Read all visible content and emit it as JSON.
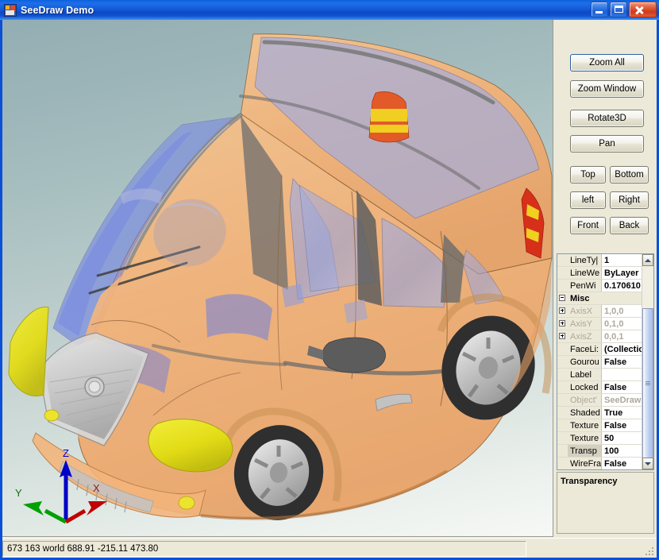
{
  "window": {
    "title": "SeeDraw Demo",
    "icon": "app-icon",
    "controls": {
      "minimize": "Minimize",
      "maximize": "Maximize",
      "close": "Close"
    }
  },
  "toolbar": {
    "buttons": [
      {
        "label": "Zoom All",
        "name": "zoom-all-button"
      },
      {
        "label": "Zoom Window",
        "name": "zoom-window-button"
      },
      {
        "label": "Rotate3D",
        "name": "rotate3d-button"
      },
      {
        "label": "Pan",
        "name": "pan-button"
      },
      {
        "label": "Top",
        "name": "view-top-button"
      },
      {
        "label": "Bottom",
        "name": "view-bottom-button"
      },
      {
        "label": "left",
        "name": "view-left-button"
      },
      {
        "label": "Right",
        "name": "view-right-button"
      },
      {
        "label": "Front",
        "name": "view-front-button"
      },
      {
        "label": "Back",
        "name": "view-back-button"
      }
    ]
  },
  "property_grid": {
    "rows": [
      {
        "expander": "none",
        "name": "LineTy|",
        "value": "1",
        "dim": false,
        "category": false,
        "selected": false
      },
      {
        "expander": "none",
        "name": "LineWe",
        "value": "ByLayer",
        "dim": false,
        "category": false,
        "selected": false
      },
      {
        "expander": "none",
        "name": "PenWi",
        "value": "0.170610",
        "dim": false,
        "category": false,
        "selected": false
      },
      {
        "expander": "minus",
        "name": "Misc",
        "value": "",
        "dim": false,
        "category": true,
        "selected": false
      },
      {
        "expander": "plus",
        "name": "AxisX",
        "value": "1,0,0",
        "dim": true,
        "category": false,
        "selected": false
      },
      {
        "expander": "plus",
        "name": "AxisY",
        "value": "0,1,0",
        "dim": true,
        "category": false,
        "selected": false
      },
      {
        "expander": "plus",
        "name": "AxisZ",
        "value": "0,0,1",
        "dim": true,
        "category": false,
        "selected": false
      },
      {
        "expander": "none",
        "name": "FaceLi:",
        "value": "(Collectio",
        "dim": false,
        "category": false,
        "selected": false
      },
      {
        "expander": "none",
        "name": "Gourou",
        "value": "False",
        "dim": false,
        "category": false,
        "selected": false
      },
      {
        "expander": "none",
        "name": "Label",
        "value": "",
        "dim": false,
        "category": false,
        "selected": false
      },
      {
        "expander": "none",
        "name": "Locked",
        "value": "False",
        "dim": false,
        "category": false,
        "selected": false
      },
      {
        "expander": "none",
        "name": "Object'",
        "value": "SeeDraw.I",
        "dim": true,
        "category": false,
        "selected": false
      },
      {
        "expander": "none",
        "name": "Shaded",
        "value": "True",
        "dim": false,
        "category": false,
        "selected": false
      },
      {
        "expander": "none",
        "name": "Texture",
        "value": "False",
        "dim": false,
        "category": false,
        "selected": false
      },
      {
        "expander": "none",
        "name": "Texture",
        "value": "50",
        "dim": false,
        "category": false,
        "selected": false
      },
      {
        "expander": "none",
        "name": "Transp",
        "value": "100",
        "dim": false,
        "category": false,
        "selected": true
      },
      {
        "expander": "none",
        "name": "WireFra",
        "value": "False",
        "dim": false,
        "category": false,
        "selected": false
      }
    ],
    "description": {
      "title": "Transparency",
      "text": ""
    },
    "scrollbar": {
      "up_arrow": "scroll-up-icon",
      "down_arrow": "scroll-down-icon"
    }
  },
  "status_bar": {
    "text": "673  163 world 688.91 -215.11 473.80",
    "screen_x": "673",
    "screen_y": "163",
    "coord_space": "world",
    "world_x": "688.91",
    "world_y": "-215.11",
    "world_z": "473.80"
  },
  "viewport": {
    "axis_labels": {
      "x": "X",
      "y": "Y",
      "z": "Z"
    },
    "model": "3d-car-model",
    "colors": {
      "body": "#F5B97A",
      "glass": "#9AA3D8",
      "glass_front": "#6C7EE4",
      "headlight": "#E8E32A",
      "taillight_red": "#E23A20",
      "taillight_yellow": "#F0D021",
      "wheel": "#3A3A3A",
      "rim": "#C9C9C9",
      "trim": "#6E6E6E",
      "grille": "#C6C6C6",
      "background_top": "#93AEB3",
      "background_bottom": "#F6F8F6",
      "axis_x": "#C00000",
      "axis_y": "#00A000",
      "axis_z": "#0000C8"
    }
  }
}
